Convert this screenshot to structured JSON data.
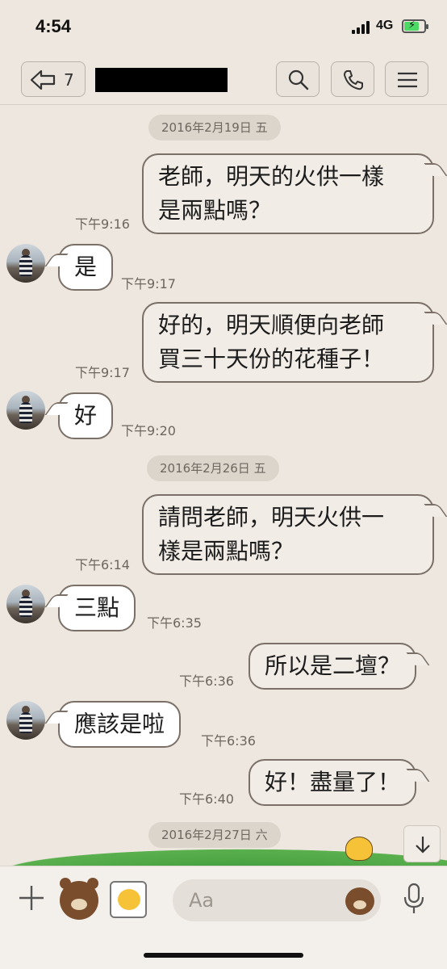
{
  "status_bar": {
    "time": "4:54",
    "network": "4G"
  },
  "header": {
    "back_count": "7"
  },
  "dates": [
    "2016年2月19日 五",
    "2016年2月26日 五",
    "2016年2月27日 六"
  ],
  "messages": [
    {
      "dir": "out",
      "text_lines": [
        "老師，明天的火供一樣",
        "是兩點嗎？"
      ],
      "time": "下午9:16"
    },
    {
      "dir": "in",
      "text_lines": [
        "是"
      ],
      "time": "下午9:17"
    },
    {
      "dir": "out",
      "text_lines": [
        "好的，明天順便向老師",
        "買三十天份的花種子！"
      ],
      "time": "下午9:17"
    },
    {
      "dir": "in",
      "text_lines": [
        "好"
      ],
      "time": "下午9:20"
    },
    {
      "dir": "out",
      "text_lines": [
        "請問老師，明天火供一",
        "樣是兩點嗎？"
      ],
      "time": "下午6:14"
    },
    {
      "dir": "in",
      "text_lines": [
        "三點"
      ],
      "time": "下午6:35"
    },
    {
      "dir": "out",
      "text_lines": [
        "所以是二壇？"
      ],
      "time": "下午6:36"
    },
    {
      "dir": "in",
      "text_lines": [
        "應該是啦"
      ],
      "time": "下午6:36"
    },
    {
      "dir": "out",
      "text_lines": [
        "好！盡量了！"
      ],
      "time": "下午6:40"
    }
  ],
  "input": {
    "placeholder": "Aa"
  },
  "icons": {
    "back": "back-arrow-icon",
    "search": "search-icon",
    "call": "phone-icon",
    "menu": "menu-icon",
    "scroll": "arrow-down-icon",
    "plus": "plus-icon",
    "mic": "microphone-icon",
    "sticker": "sticker-icon",
    "emoji": "emoji-icon"
  },
  "colors": {
    "background": "#ede7df",
    "bubble_out": "#f1ece6",
    "bubble_in": "#ffffff",
    "grass": "#5bb04e"
  }
}
